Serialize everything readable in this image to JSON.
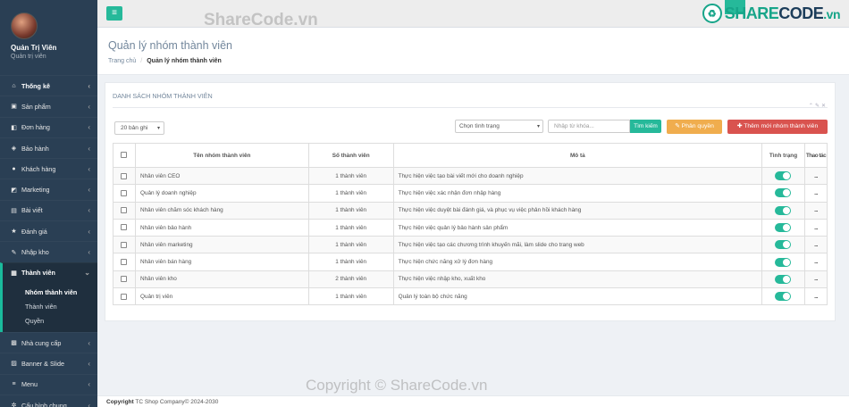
{
  "user": {
    "name": "Quản Trị Viên",
    "role": "Quản trị viên"
  },
  "sidebar": {
    "items": [
      {
        "label": "Thống kê",
        "icon": "home-icon"
      },
      {
        "label": "Sản phẩm",
        "icon": "box-icon"
      },
      {
        "label": "Đơn hàng",
        "icon": "cart-icon"
      },
      {
        "label": "Bảo hành",
        "icon": "shield-icon"
      },
      {
        "label": "Khách hàng",
        "icon": "user-icon"
      },
      {
        "label": "Marketing",
        "icon": "megaphone-icon"
      },
      {
        "label": "Bài viết",
        "icon": "article-icon"
      },
      {
        "label": "Đánh giá",
        "icon": "star-icon"
      },
      {
        "label": "Nhập kho",
        "icon": "edit-icon"
      },
      {
        "label": "Thành viên",
        "icon": "grid-icon"
      }
    ],
    "submenu": [
      "Nhóm thành viên",
      "Thành viên",
      "Quyền"
    ],
    "items_after": [
      {
        "label": "Nhà cung cấp",
        "icon": "truck-icon"
      },
      {
        "label": "Banner & Slide",
        "icon": "image-icon"
      },
      {
        "label": "Menu",
        "icon": "menu-icon"
      },
      {
        "label": "Cấu hình chung",
        "icon": "gear-icon"
      }
    ]
  },
  "topbar": {
    "brand_prefix": "S",
    "brand_mid": "HARE",
    "brand_suffix": "CODE",
    "brand_tld": ".vn"
  },
  "header": {
    "title": "Quản lý nhóm thành viên",
    "breadcrumb_home": "Trang chủ",
    "breadcrumb_current": "Quản lý nhóm thành viên"
  },
  "panel": {
    "title": "DANH SÁCH NHÓM THÀNH VIÊN",
    "page_size": "20 bản ghi",
    "status_placeholder": "Chọn tình trạng",
    "keyword_placeholder": "Nhập từ khóa...",
    "search_label": "Tìm kiếm",
    "permission_label": "Phân quyền",
    "add_label": "Thêm mới nhóm thành viên"
  },
  "table": {
    "headers": {
      "name": "Tên nhóm thành viên",
      "count": "Số thành viên",
      "desc": "Mô tả",
      "status": "Tình trạng",
      "action": "Thao tác"
    },
    "rows": [
      {
        "name": "Nhân viên CEO",
        "count": "1 thành viên",
        "desc": "Thực hiện việc tạo bài viết mới cho doanh nghiệp"
      },
      {
        "name": "Quản lý doanh nghiệp",
        "count": "1 thành viên",
        "desc": "Thực hiện việc xác nhận đơn nhập hàng"
      },
      {
        "name": "Nhân viên chăm sóc khách hàng",
        "count": "1 thành viên",
        "desc": "Thực hiện việc duyệt bài đánh giá, và phục vụ việc phản hồi khách hàng"
      },
      {
        "name": "Nhân viên bảo hành",
        "count": "1 thành viên",
        "desc": "Thực hiện việc quản lý bảo hành sản phẩm"
      },
      {
        "name": "Nhân viên marketing",
        "count": "1 thành viên",
        "desc": "Thực hiện việc tạo các chương trình khuyến mãi, làm slide cho trang web"
      },
      {
        "name": "Nhân viên bán hàng",
        "count": "1 thành viên",
        "desc": "Thực hiện chức năng xử lý đơn hàng"
      },
      {
        "name": "Nhân viên kho",
        "count": "2 thành viên",
        "desc": "Thực hiện việc nhập kho, xuất kho"
      },
      {
        "name": "Quản trị viên",
        "count": "1 thành viên",
        "desc": "Quản lý toàn bộ chức năng"
      }
    ],
    "action_text": "..."
  },
  "footer": {
    "bold": "Copyright",
    "text": " TC Shop Company© 2024-2030"
  },
  "watermark": {
    "top": "ShareCode.vn",
    "bottom": "Copyright © ShareCode.vn"
  },
  "colors": {
    "sidebar": "#2a3f54",
    "accent": "#26b99a",
    "warning": "#f0ad4e",
    "danger": "#d9534f"
  }
}
